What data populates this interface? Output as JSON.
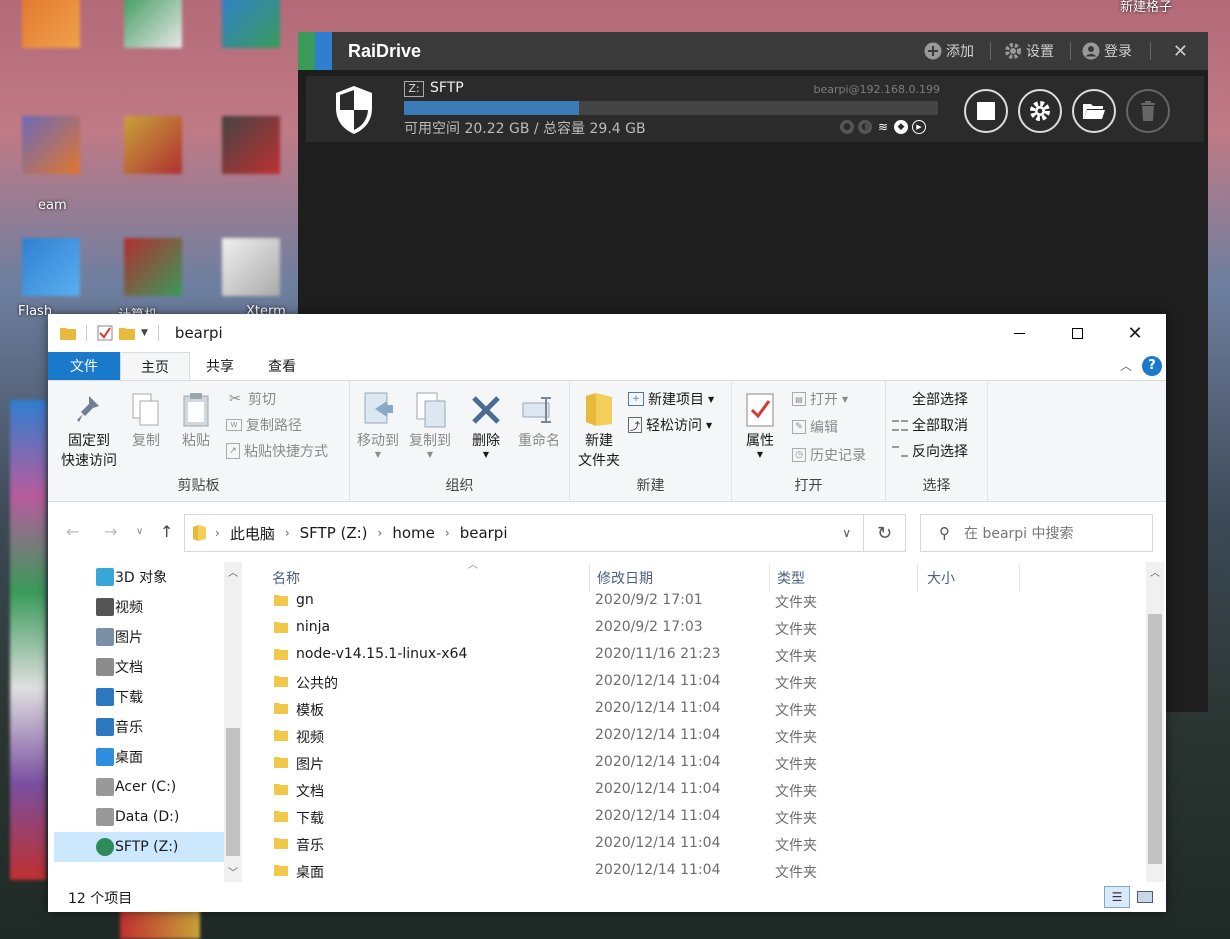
{
  "desktop": {
    "icon_labels": [
      "eam",
      "Flash",
      "计算机",
      "Xterm"
    ],
    "top_right_label": "新建格子",
    "colors": {
      "icon1": "#e2762d",
      "icon2": "#3a9a5a",
      "icon3": "#2f7fd0",
      "icon4": "#b85c9e",
      "icon5": "#c8a23a",
      "icon6": "#7a4fa0"
    }
  },
  "raidrive": {
    "title": "RaiDrive",
    "toolbar": {
      "add": "添加",
      "settings": "设置",
      "login": "登录",
      "close": "✕"
    },
    "drive": {
      "letter": "Z:",
      "name": "SFTP",
      "host": "bearpi@192.168.0.199",
      "space_text": "可用空间 20.22 GB / 总容量 29.4 GB",
      "used_fraction": 0.327,
      "status_icons": [
        "pin-icon",
        "sync-icon",
        "wifi-icon",
        "shield-icon",
        "play-icon"
      ]
    },
    "buttons": [
      "disconnect-button",
      "settings-button",
      "open-folder-button",
      "delete-button"
    ],
    "colors": {
      "accent": "#3d7ab8",
      "bg": "#1e1e1e"
    }
  },
  "explorer": {
    "title": "bearpi",
    "tabs": [
      {
        "label": "文件",
        "kind": "file"
      },
      {
        "label": "主页",
        "kind": "active"
      },
      {
        "label": "共享",
        "kind": "normal"
      },
      {
        "label": "查看",
        "kind": "normal"
      }
    ],
    "help": "?",
    "ribbon": {
      "pin_quick": [
        "固定到",
        "快速访问"
      ],
      "copy": "复制",
      "paste": "粘贴",
      "cut": "剪切",
      "copy_path": "复制路径",
      "paste_shortcut": "粘贴快捷方式",
      "clipboard_label": "剪贴板",
      "move_to": "移动到",
      "copy_to": "复制到",
      "delete": "删除",
      "rename": "重命名",
      "organize_label": "组织",
      "new_folder": [
        "新建",
        "文件夹"
      ],
      "new_item": "新建项目",
      "easy_access": "轻松访问",
      "new_label": "新建",
      "properties": "属性",
      "open": "打开",
      "edit": "编辑",
      "history": "历史记录",
      "open_label": "打开",
      "select_all": "全部选择",
      "select_none": "全部取消",
      "invert_selection": "反向选择",
      "select_label": "选择"
    },
    "address": {
      "crumbs": [
        "此电脑",
        "SFTP (Z:)",
        "home",
        "bearpi"
      ],
      "search_placeholder": "在 bearpi 中搜索"
    },
    "nav": [
      {
        "label": "3D 对象",
        "icon": "3d-objects-icon"
      },
      {
        "label": "视频",
        "icon": "video-icon"
      },
      {
        "label": "图片",
        "icon": "pictures-icon"
      },
      {
        "label": "文档",
        "icon": "documents-icon"
      },
      {
        "label": "下载",
        "icon": "downloads-icon"
      },
      {
        "label": "音乐",
        "icon": "music-icon"
      },
      {
        "label": "桌面",
        "icon": "desktop-icon"
      },
      {
        "label": "Acer (C:)",
        "icon": "windows-drive-icon"
      },
      {
        "label": "Data (D:)",
        "icon": "drive-icon"
      },
      {
        "label": "SFTP (Z:)",
        "icon": "network-drive-icon",
        "selected": true
      }
    ],
    "columns": {
      "name": "名称",
      "modified": "修改日期",
      "type": "类型",
      "size": "大小"
    },
    "files": [
      {
        "name": "gn",
        "modified": "2020/9/2 17:01",
        "type": "文件夹"
      },
      {
        "name": "ninja",
        "modified": "2020/9/2 17:03",
        "type": "文件夹"
      },
      {
        "name": "node-v14.15.1-linux-x64",
        "modified": "2020/11/16 21:23",
        "type": "文件夹"
      },
      {
        "name": "公共的",
        "modified": "2020/12/14 11:04",
        "type": "文件夹"
      },
      {
        "name": "模板",
        "modified": "2020/12/14 11:04",
        "type": "文件夹"
      },
      {
        "name": "视频",
        "modified": "2020/12/14 11:04",
        "type": "文件夹"
      },
      {
        "name": "图片",
        "modified": "2020/12/14 11:04",
        "type": "文件夹"
      },
      {
        "name": "文档",
        "modified": "2020/12/14 11:04",
        "type": "文件夹"
      },
      {
        "name": "下载",
        "modified": "2020/12/14 11:04",
        "type": "文件夹"
      },
      {
        "name": "音乐",
        "modified": "2020/12/14 11:04",
        "type": "文件夹"
      },
      {
        "name": "桌面",
        "modified": "2020/12/14 11:04",
        "type": "文件夹"
      }
    ],
    "status": {
      "item_count": "12 个项目"
    },
    "colors": {
      "accent": "#1979ca",
      "folder": "#f2c84b",
      "selected": "#cce8ff"
    }
  }
}
